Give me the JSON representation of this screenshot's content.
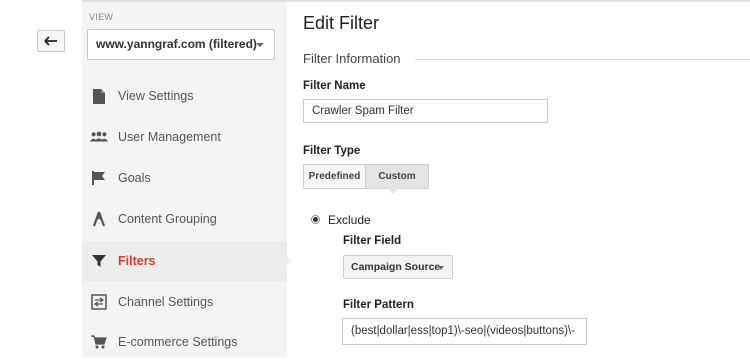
{
  "sidebar": {
    "view_label": "VIEW",
    "view_selected": "www.yanngraf.com (filtered)",
    "items": [
      {
        "label": "View Settings",
        "icon": "document-icon"
      },
      {
        "label": "User Management",
        "icon": "users-icon"
      },
      {
        "label": "Goals",
        "icon": "flag-icon"
      },
      {
        "label": "Content Grouping",
        "icon": "person-walking-icon"
      },
      {
        "label": "Filters",
        "icon": "funnel-icon",
        "active": true
      },
      {
        "label": "Channel Settings",
        "icon": "channel-settings-icon"
      },
      {
        "label": "E-commerce Settings",
        "icon": "cart-icon"
      }
    ]
  },
  "main": {
    "title": "Edit Filter",
    "section_title": "Filter Information",
    "filter_name_label": "Filter Name",
    "filter_name_value": "Crawler Spam Filter",
    "filter_type_label": "Filter Type",
    "tabs": [
      "Predefined",
      "Custom"
    ],
    "selected_tab": "Custom",
    "radio_label": "Exclude",
    "filter_field_label": "Filter Field",
    "filter_field_value": "Campaign Source",
    "filter_pattern_label": "Filter Pattern",
    "filter_pattern_value": "(best|dollar|ess|top1)\\-seo|(videos|buttons)\\-"
  },
  "colors": {
    "accent_active": "#d23f31",
    "sidebar_bg": "#f4f4f4"
  }
}
